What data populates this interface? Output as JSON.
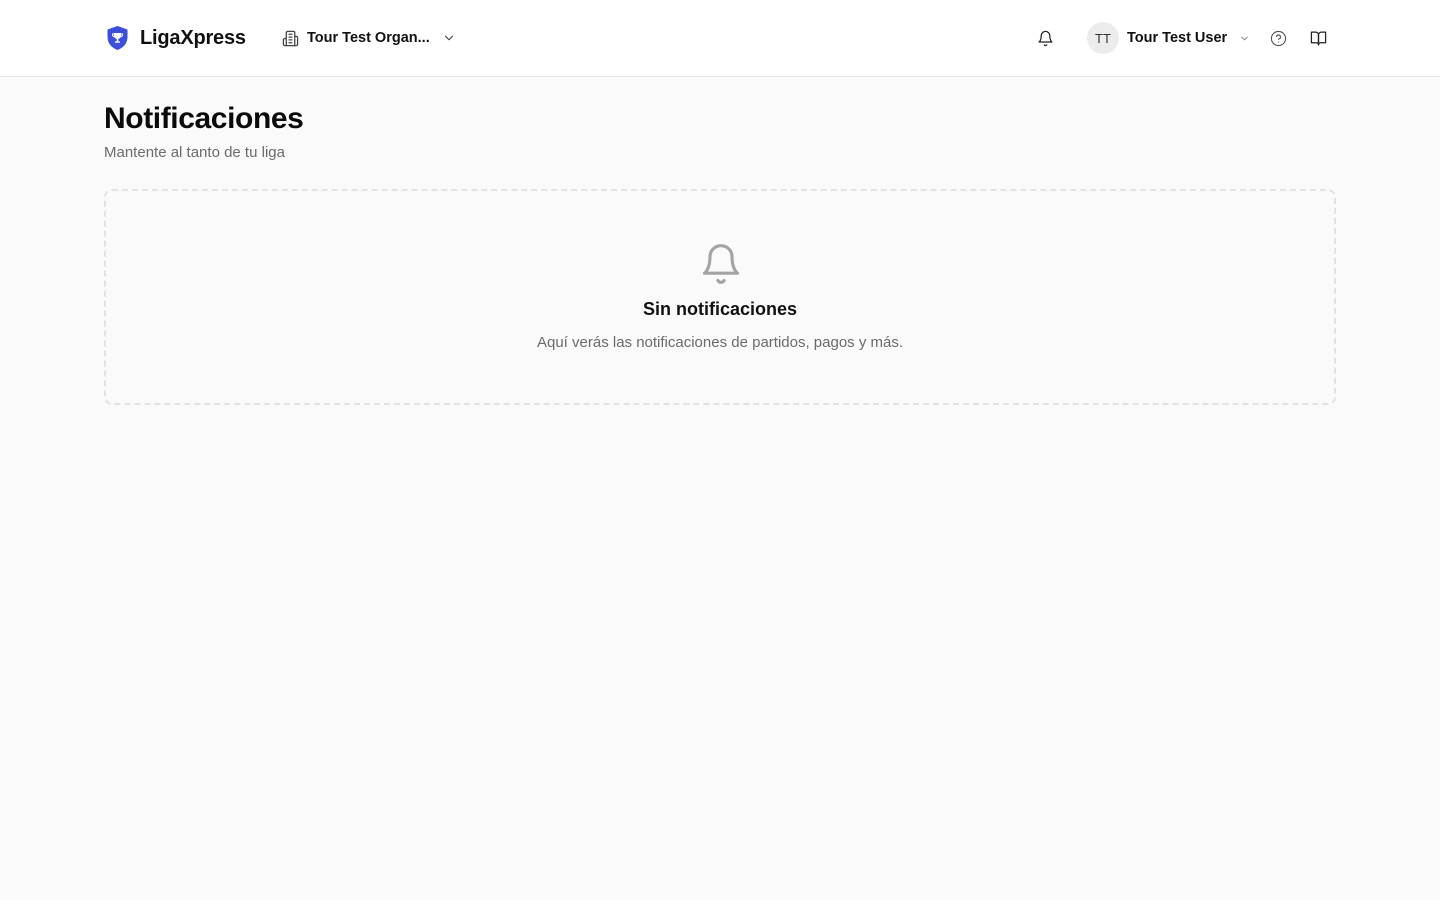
{
  "app": {
    "name": "LigaXpress",
    "brand_color": "#3b4fd8"
  },
  "header": {
    "organization": "Tour Test Organ...",
    "user_initials": "TT",
    "user_name": "Tour Test User",
    "icons": [
      "trophy-shield-logo",
      "building-icon",
      "chevron-down-icon",
      "bell-icon",
      "help-circle-icon",
      "book-open-icon"
    ]
  },
  "page": {
    "title": "Notificaciones",
    "subtitle": "Mantente al tanto de tu liga"
  },
  "empty_state": {
    "icon": "bell-icon",
    "title": "Sin notificaciones",
    "message": "Aquí verás las notificaciones de partidos, pagos y más."
  }
}
